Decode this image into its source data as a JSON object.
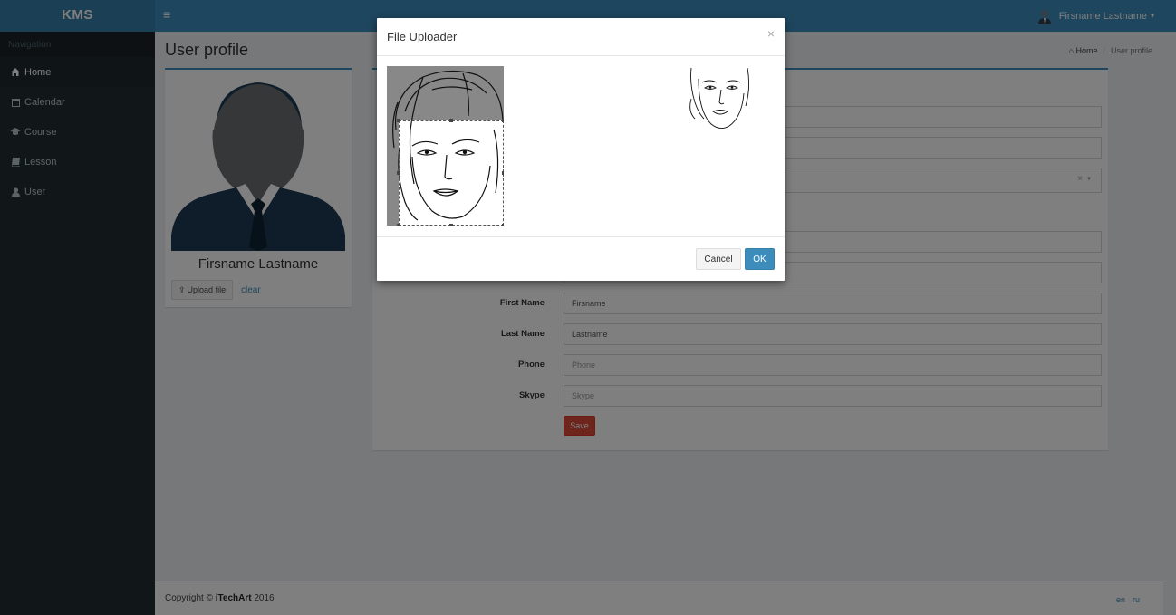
{
  "app": {
    "logo": "KMS"
  },
  "topbar": {
    "menu_icon": "hamburger-icon",
    "user_name": "Firsname Lastname",
    "caret": "▾"
  },
  "sidebar": {
    "header": "Navigation",
    "items": [
      {
        "label": "Home",
        "icon": "home-icon",
        "active": true
      },
      {
        "label": "Calendar",
        "icon": "calendar-icon",
        "active": false
      },
      {
        "label": "Course",
        "icon": "graduation-cap-icon",
        "active": false
      },
      {
        "label": "Lesson",
        "icon": "book-icon",
        "active": false
      },
      {
        "label": "User",
        "icon": "user-icon",
        "active": false
      }
    ]
  },
  "page": {
    "title": "User profile"
  },
  "breadcrumb": {
    "home": "Home",
    "separator": "/",
    "current": "User profile"
  },
  "profile": {
    "name": "Firsname Lastname",
    "upload_label": "Upload file",
    "clear_label": "clear"
  },
  "form": {
    "first_name": {
      "label": "First Name",
      "value": "Firsname"
    },
    "last_name": {
      "label": "Last Name",
      "value": "Lastname"
    },
    "phone": {
      "label": "Phone",
      "placeholder": "Phone"
    },
    "skype": {
      "label": "Skype",
      "placeholder": "Skype"
    },
    "select_clear": "×",
    "save_label": "Save"
  },
  "footer": {
    "copyright_prefix": "Copyright ©",
    "company": "iTechArt",
    "year": "2016",
    "lang_en": "en",
    "lang_ru": "ru"
  },
  "modal": {
    "title": "File Uploader",
    "close": "×",
    "cancel_label": "Cancel",
    "ok_label": "OK"
  },
  "colors": {
    "primary": "#3c8dbc",
    "danger": "#dd4b39",
    "sidebar": "#222d32"
  }
}
